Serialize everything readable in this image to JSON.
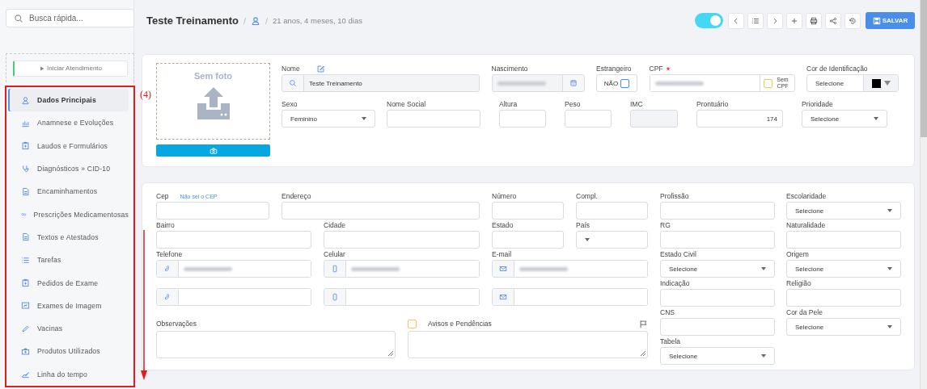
{
  "sidebar": {
    "search": {
      "placeholder": "Busca rápida..."
    },
    "start_button": {
      "label": "Iniciar Atendimento"
    },
    "nav": [
      {
        "label": "Dados Principais",
        "selected": true
      },
      {
        "label": "Anamnese e Evoluções",
        "selected": false
      },
      {
        "label": "Laudos e Formulários",
        "selected": false
      },
      {
        "label": "Diagnósticos » CID-10",
        "selected": false
      },
      {
        "label": "Encaminhamentos",
        "selected": false
      },
      {
        "label": "Prescrições Medicamentosas",
        "selected": false
      },
      {
        "label": "Textos e Atestados",
        "selected": false
      },
      {
        "label": "Tarefas",
        "selected": false
      },
      {
        "label": "Pedidos de Exame",
        "selected": false
      },
      {
        "label": "Exames de Imagem",
        "selected": false
      },
      {
        "label": "Vacinas",
        "selected": false
      },
      {
        "label": "Produtos Utilizados",
        "selected": false
      },
      {
        "label": "Linha do tempo",
        "selected": false
      }
    ]
  },
  "annotation": {
    "label": "(4)"
  },
  "header": {
    "title": "Teste Treinamento",
    "separators": [
      "/",
      "/"
    ],
    "subtitle": "21 anos, 4 meses, 10 dias"
  },
  "toolbar": {
    "toggle": {
      "on": true
    },
    "save_button": {
      "label": "SALVAR"
    }
  },
  "photo": {
    "title": "Sem foto"
  },
  "profile_rows": [
    [
      {
        "kind": "search",
        "label": "Nome",
        "editable": true,
        "value": "Teste Treinamento"
      },
      {
        "kind": "date",
        "label": "Nascimento",
        "redacted": true
      },
      {
        "kind": "check",
        "label": "Estrangeiro",
        "text": "NÃO",
        "checked": false
      },
      {
        "kind": "cpf",
        "label": "CPF",
        "required": true,
        "redacted": true,
        "addon_text": "Sem CPF",
        "checked": false
      },
      {
        "kind": "color",
        "label": "Cor de Identificação",
        "value": "Selecione",
        "color": "#000000"
      }
    ],
    [
      {
        "kind": "select",
        "label": "Sexo",
        "value": "Feminino"
      },
      {
        "kind": "text",
        "label": "Nome Social"
      },
      {
        "kind": "text",
        "label": "Altura"
      },
      {
        "kind": "text",
        "label": "Peso"
      },
      {
        "kind": "text",
        "label": "IMC",
        "disabled": true
      },
      {
        "kind": "text",
        "label": "Prontuário",
        "value": "174"
      },
      {
        "kind": "select",
        "label": "Prioridade",
        "value": "Selecione"
      }
    ]
  ],
  "contact_rows": [
    [
      {
        "kind": "text",
        "label": "Cep",
        "link": "Não sei o CEP"
      },
      {
        "kind": "text",
        "label": "Endereço"
      },
      {
        "kind": "text",
        "label": "Número"
      },
      {
        "kind": "text",
        "label": "Compl."
      }
    ],
    [
      {
        "kind": "text",
        "label": "Bairro"
      },
      {
        "kind": "text",
        "label": "Cidade"
      },
      {
        "kind": "text",
        "label": "Estado"
      },
      {
        "kind": "select",
        "label": "País"
      }
    ],
    [
      {
        "kind": "phone",
        "label": "Telefone",
        "redacted": true
      },
      {
        "kind": "mobile",
        "label": "Celular",
        "redacted": true
      },
      {
        "kind": "email",
        "label": "E-mail",
        "redacted": true
      }
    ],
    [
      {
        "kind": "phone"
      },
      {
        "kind": "mobile"
      },
      {
        "kind": "email"
      }
    ],
    [
      {
        "kind": "textarea",
        "label": "Observações"
      },
      {
        "kind": "textarea",
        "label": "Avisos e Pendências",
        "checked": false,
        "flag": true
      }
    ]
  ],
  "contact_side": [
    {
      "kind": "text",
      "label": "Profissão"
    },
    {
      "kind": "select",
      "label": "Escolaridade",
      "value": "Selecione"
    },
    {
      "kind": "text",
      "label": "RG"
    },
    {
      "kind": "text",
      "label": "Naturalidade"
    },
    {
      "kind": "select",
      "label": "Estado Civil",
      "value": "Selecione"
    },
    {
      "kind": "select",
      "label": "Origem",
      "value": "Selecione"
    },
    {
      "kind": "text",
      "label": "Indicação"
    },
    {
      "kind": "text",
      "label": "Religião"
    },
    {
      "kind": "text",
      "label": "CNS"
    },
    {
      "kind": "select",
      "label": "Cor da Pele",
      "value": "Selecione"
    },
    {
      "kind": "select",
      "label": "Tabela",
      "value": "Selecione"
    }
  ]
}
